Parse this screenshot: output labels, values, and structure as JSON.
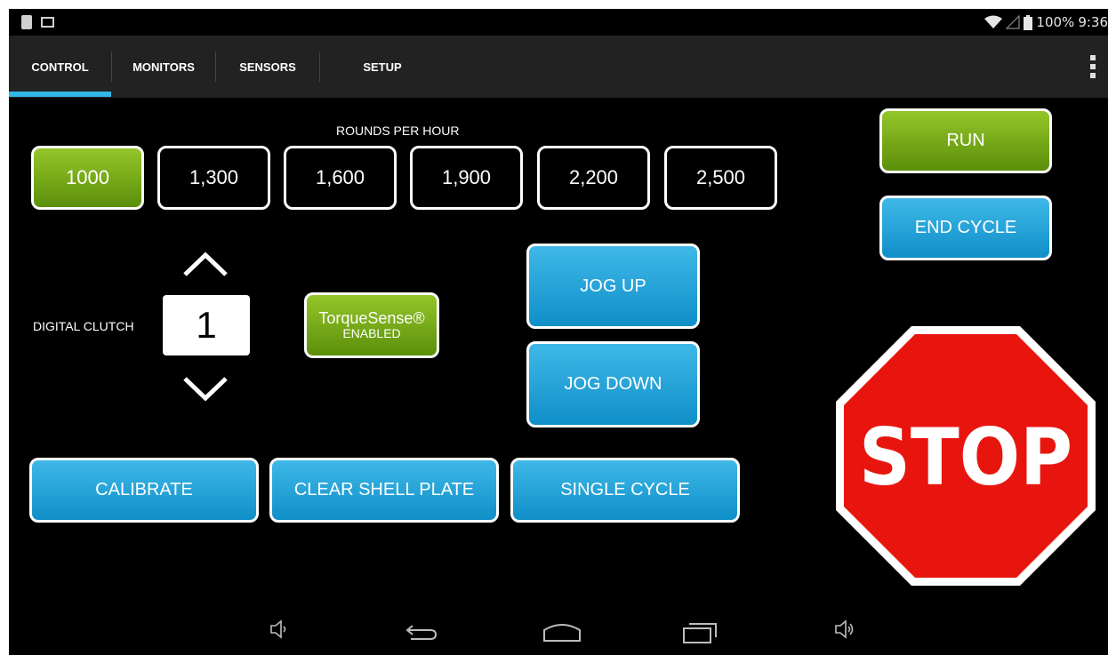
{
  "status_bar": {
    "battery": "100%",
    "time": "9:36"
  },
  "tabs": [
    {
      "label": "CONTROL"
    },
    {
      "label": "MONITORS"
    },
    {
      "label": "SENSORS"
    },
    {
      "label": "SETUP"
    }
  ],
  "rounds_per_hour": {
    "label": "ROUNDS PER HOUR",
    "options": [
      "1000",
      "1,300",
      "1,600",
      "1,900",
      "2,200",
      "2,500"
    ],
    "selected": "1000"
  },
  "digital_clutch": {
    "label": "DIGITAL CLUTCH",
    "value": "1"
  },
  "torque_sense": {
    "title": "TorqueSense®",
    "status": "ENABLED"
  },
  "buttons": {
    "run": "RUN",
    "end_cycle": "END CYCLE",
    "jog_up": "JOG UP",
    "jog_down": "JOG DOWN",
    "calibrate": "CALIBRATE",
    "clear_shell_plate": "CLEAR SHELL PLATE",
    "single_cycle": "SINGLE CYCLE",
    "stop": "STOP"
  },
  "colors": {
    "accent_blue": "#33b5e5",
    "run_green": "#7fb31a",
    "stop_red": "#e8150f"
  },
  "icons": {
    "status_left": [
      "usb-debug-icon",
      "image-notification-icon"
    ],
    "status_right": [
      "wifi-icon",
      "signal-icon",
      "battery-icon"
    ],
    "nav": [
      "volume-down-icon",
      "back-icon",
      "home-icon",
      "recent-apps-icon",
      "volume-up-icon"
    ]
  }
}
